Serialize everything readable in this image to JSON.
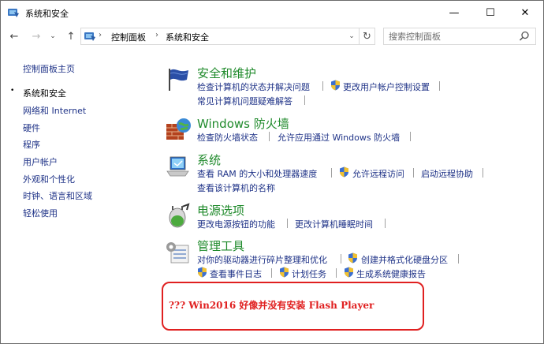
{
  "window": {
    "title": "系统和安全",
    "minimize": "—",
    "maximize": "☐",
    "close": "✕"
  },
  "nav": {
    "back": "←",
    "forward": "→",
    "recent": "⌄",
    "up": "↑",
    "breadcrumb": [
      "控制面板",
      "系统和安全"
    ],
    "chevron": "›",
    "dropdown": "⌄",
    "refresh": "↻",
    "search_placeholder": "搜索控制面板"
  },
  "sidebar": {
    "home": "控制面板主页",
    "bullet": "•",
    "items": [
      {
        "label": "系统和安全",
        "active": true
      },
      {
        "label": "网络和 Internet"
      },
      {
        "label": "硬件"
      },
      {
        "label": "程序"
      },
      {
        "label": "用户帐户"
      },
      {
        "label": "外观和个性化"
      },
      {
        "label": "时钟、语言和区域"
      },
      {
        "label": "轻松使用"
      }
    ]
  },
  "categories": [
    {
      "title": "安全和维护",
      "icon": "security-flag-icon",
      "links_row1": [
        "检查计算机的状态并解决问题",
        "更改用户帐户控制设置"
      ],
      "links_row2": [
        "常见计算机问题疑难解答"
      ]
    },
    {
      "title": "Windows 防火墙",
      "icon": "firewall-icon",
      "links_row1": [
        "检查防火墙状态",
        "允许应用通过 Windows 防火墙"
      ]
    },
    {
      "title": "系统",
      "icon": "system-computer-icon",
      "links_row1": [
        "查看 RAM 的大小和处理器速度",
        "允许远程访问",
        "启动远程协助"
      ],
      "links_row2": [
        "查看该计算机的名称"
      ]
    },
    {
      "title": "电源选项",
      "icon": "power-options-icon",
      "links_row1": [
        "更改电源按钮的功能",
        "更改计算机睡眠时间"
      ]
    },
    {
      "title": "管理工具",
      "icon": "admin-tools-icon",
      "links_row1": [
        "对你的驱动器进行碎片整理和优化",
        "创建并格式化硬盘分区"
      ],
      "links_row2": [
        "查看事件日志",
        "计划任务",
        "生成系统健康报告"
      ]
    }
  ],
  "annotation": {
    "text": "??? Win2016 好像并没有安装 Flash Player",
    "color": "#e02020"
  },
  "colors": {
    "link": "#1e3287",
    "heading": "#1f8a2b"
  }
}
